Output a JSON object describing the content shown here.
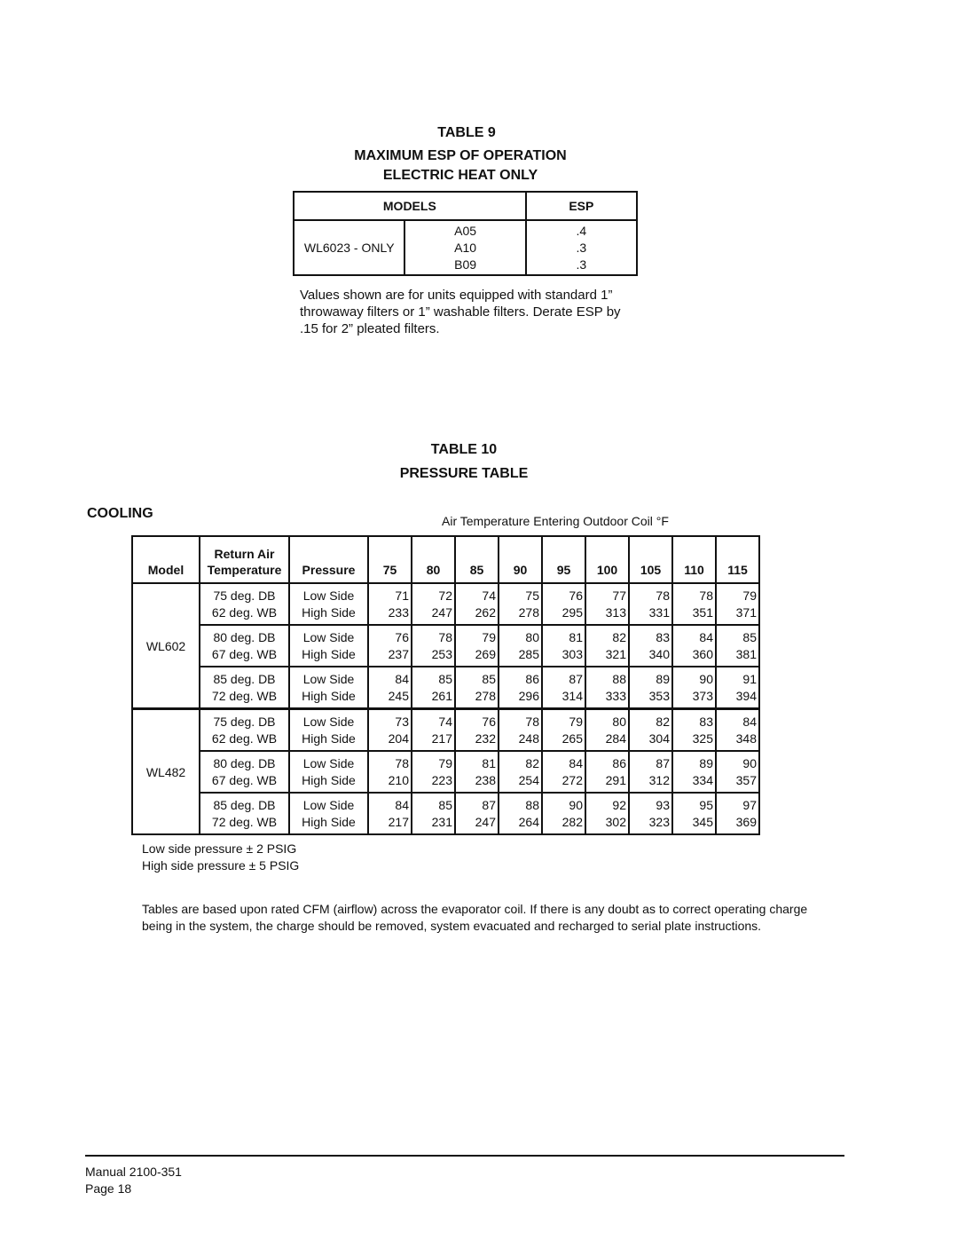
{
  "table9": {
    "number": "TABLE  9",
    "title_line1": "MAXIMUM ESP OF OPERATION",
    "title_line2": "ELECTRIC HEAT ONLY",
    "headers": {
      "models": "MODELS",
      "esp": "ESP"
    },
    "model": "WL6023 - ONLY",
    "rows": [
      {
        "option": "A05",
        "esp": ".4"
      },
      {
        "option": "A10",
        "esp": ".3"
      },
      {
        "option": "B09",
        "esp": ".3"
      }
    ],
    "note": "Values shown are for units equipped with standard 1” throwaway filters or 1” washable filters.  Derate ESP by .15 for 2” pleated filters."
  },
  "table10": {
    "number": "TABLE  10",
    "title": "PRESSURE TABLE",
    "section": "COOLING",
    "caption": "Air Temperature Entering Outdoor Coil °F",
    "headers": {
      "model": "Model",
      "return_air_line1": "Return Air",
      "return_air_line2": "Temperature",
      "pressure": "Pressure",
      "temps": [
        "75",
        "80",
        "85",
        "90",
        "95",
        "100",
        "105",
        "110",
        "115"
      ]
    },
    "models": [
      {
        "name": "WL602",
        "groups": [
          {
            "db": "75 deg. DB",
            "wb": "62 deg. WB",
            "low_label": "Low Side",
            "high_label": "High Side",
            "low": [
              "71",
              "72",
              "74",
              "75",
              "76",
              "77",
              "78",
              "78",
              "79"
            ],
            "high": [
              "233",
              "247",
              "262",
              "278",
              "295",
              "313",
              "331",
              "351",
              "371"
            ]
          },
          {
            "db": "80 deg. DB",
            "wb": "67 deg. WB",
            "low_label": "Low Side",
            "high_label": "High Side",
            "low": [
              "76",
              "78",
              "79",
              "80",
              "81",
              "82",
              "83",
              "84",
              "85"
            ],
            "high": [
              "237",
              "253",
              "269",
              "285",
              "303",
              "321",
              "340",
              "360",
              "381"
            ]
          },
          {
            "db": "85 deg. DB",
            "wb": "72 deg. WB",
            "low_label": "Low Side",
            "high_label": "High Side",
            "low": [
              "84",
              "85",
              "85",
              "86",
              "87",
              "88",
              "89",
              "90",
              "91"
            ],
            "high": [
              "245",
              "261",
              "278",
              "296",
              "314",
              "333",
              "353",
              "373",
              "394"
            ]
          }
        ]
      },
      {
        "name": "WL482",
        "groups": [
          {
            "db": "75 deg. DB",
            "wb": "62 deg. WB",
            "low_label": "Low Side",
            "high_label": "High Side",
            "low": [
              "73",
              "74",
              "76",
              "78",
              "79",
              "80",
              "82",
              "83",
              "84"
            ],
            "high": [
              "204",
              "217",
              "232",
              "248",
              "265",
              "284",
              "304",
              "325",
              "348"
            ]
          },
          {
            "db": "80 deg. DB",
            "wb": "67 deg. WB",
            "low_label": "Low Side",
            "high_label": "High Side",
            "low": [
              "78",
              "79",
              "81",
              "82",
              "84",
              "86",
              "87",
              "89",
              "90"
            ],
            "high": [
              "210",
              "223",
              "238",
              "254",
              "272",
              "291",
              "312",
              "334",
              "357"
            ]
          },
          {
            "db": "85 deg. DB",
            "wb": "72 deg. WB",
            "low_label": "Low Side",
            "high_label": "High Side",
            "low": [
              "84",
              "85",
              "87",
              "88",
              "90",
              "92",
              "93",
              "95",
              "97"
            ],
            "high": [
              "217",
              "231",
              "247",
              "264",
              "282",
              "302",
              "323",
              "345",
              "369"
            ]
          }
        ]
      }
    ],
    "tolerances": [
      "Low side pressure  ± 2 PSIG",
      "High side pressure  ± 5 PSIG"
    ],
    "footnote": "Tables are based upon rated CFM (airflow) across the evaporator coil.  If there is any doubt as to correct operating charge being in the system, the charge should be removed, system evacuated and recharged to serial plate instructions."
  },
  "footer": {
    "manual": "Manual   2100-351",
    "page": "Page  18"
  }
}
